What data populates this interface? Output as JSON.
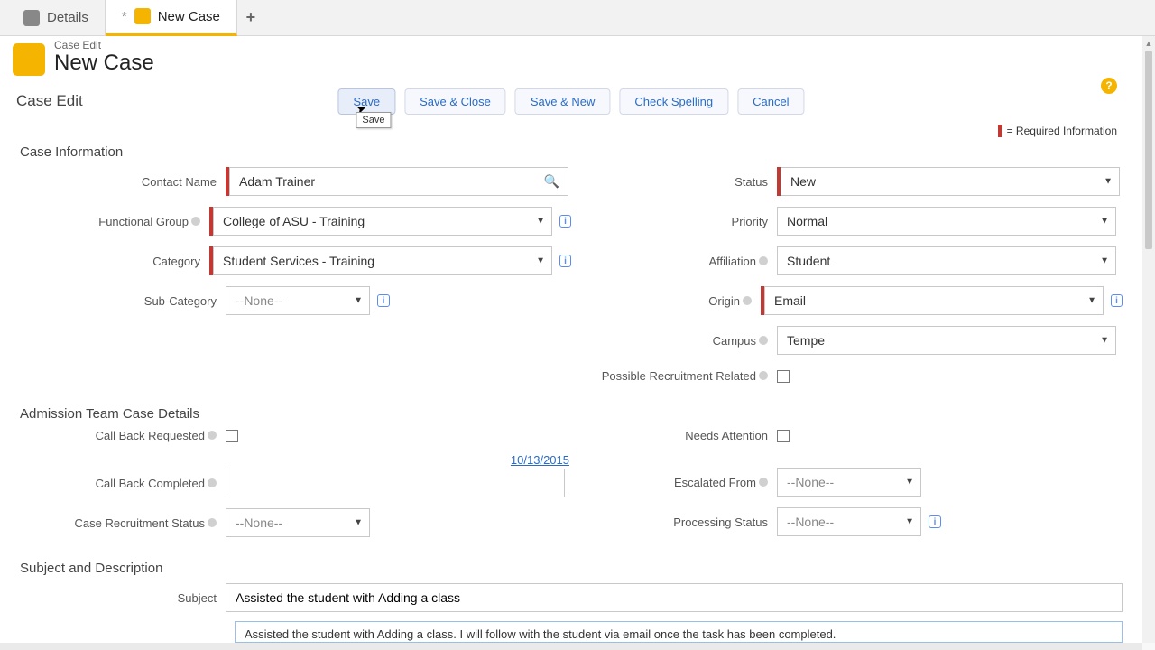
{
  "tabs": {
    "details": "Details",
    "new_case": "New Case",
    "dirty_marker": "*"
  },
  "page": {
    "eyebrow": "Case Edit",
    "title": "New Case"
  },
  "actions": {
    "section_label": "Case Edit",
    "save": "Save",
    "save_close": "Save & Close",
    "save_new": "Save & New",
    "check_spelling": "Check Spelling",
    "cancel": "Cancel",
    "save_tooltip": "Save"
  },
  "required_legend": "= Required Information",
  "sections": {
    "case_info": "Case Information",
    "admission": "Admission Team Case Details",
    "subject": "Subject and Description"
  },
  "labels": {
    "contact_name": "Contact Name",
    "functional_group": "Functional Group",
    "category": "Category",
    "sub_category": "Sub-Category",
    "status": "Status",
    "priority": "Priority",
    "affiliation": "Affiliation",
    "origin": "Origin",
    "campus": "Campus",
    "possible_recruitment": "Possible Recruitment Related",
    "call_back_requested": "Call Back Requested",
    "call_back_completed": "Call Back Completed",
    "case_recruitment_status": "Case Recruitment Status",
    "needs_attention": "Needs Attention",
    "escalated_from": "Escalated From",
    "processing_status": "Processing Status",
    "subject": "Subject"
  },
  "values": {
    "contact_name": "Adam Trainer",
    "functional_group": "College of ASU - Training",
    "category": "Student Services - Training",
    "sub_category": "--None--",
    "status": "New",
    "priority": "Normal",
    "affiliation": "Student",
    "origin": "Email",
    "campus": "Tempe",
    "call_back_date_link": "10/13/2015",
    "case_recruitment_status": "--None--",
    "escalated_from": "--None--",
    "processing_status": "--None--",
    "subject": "Assisted the student with Adding a class",
    "description": "Assisted the student with Adding a class. I will follow with the student via email once the task has been completed."
  }
}
